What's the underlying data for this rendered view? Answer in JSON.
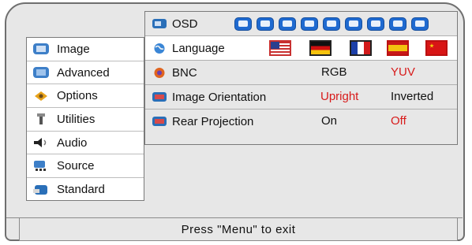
{
  "menu": {
    "items": [
      {
        "label": "Image",
        "icon": "image-icon"
      },
      {
        "label": "Advanced",
        "icon": "advanced-icon"
      },
      {
        "label": "Options",
        "icon": "options-icon",
        "selected": true
      },
      {
        "label": "Utilities",
        "icon": "utilities-icon"
      },
      {
        "label": "Audio",
        "icon": "speaker-icon"
      },
      {
        "label": "Source",
        "icon": "source-icon"
      },
      {
        "label": "Standard",
        "icon": "standard-icon"
      }
    ]
  },
  "panel": {
    "osd": {
      "label": "OSD",
      "tab_count": 9
    },
    "language": {
      "label": "Language",
      "flags": [
        "us-flag-icon",
        "germany-flag-icon",
        "france-flag-icon",
        "spain-flag-icon",
        "china-flag-icon"
      ]
    },
    "bnc": {
      "label": "BNC",
      "options": [
        "RGB",
        "YUV"
      ],
      "selected": "YUV"
    },
    "orientation": {
      "label": "Image Orientation",
      "options": [
        "Upright",
        "Inverted"
      ],
      "selected": "Upright"
    },
    "rear_projection": {
      "label": "Rear Projection",
      "options": [
        "On",
        "Off"
      ],
      "selected": "Off"
    }
  },
  "status": {
    "text": "Press \"Menu\" to exit"
  },
  "colors": {
    "selected_option": "#d81a1a",
    "accent_blue": "#1f6ad0",
    "frame_bg": "#e7e7e7"
  }
}
